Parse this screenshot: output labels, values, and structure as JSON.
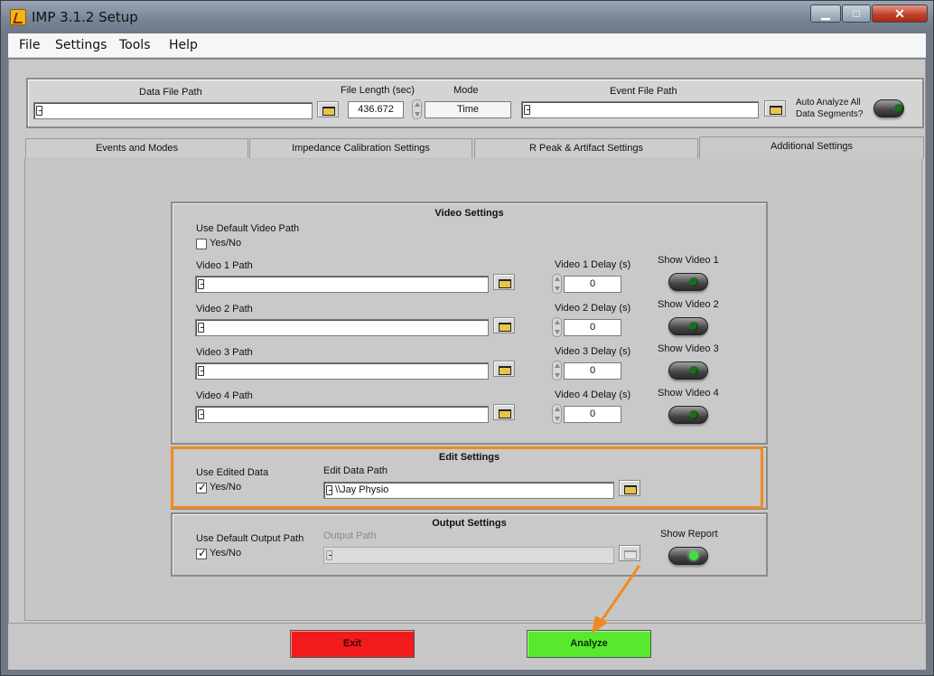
{
  "window": {
    "title": "IMP 3.1.2 Setup",
    "controls": {
      "minimize": "▁",
      "maximize": "□",
      "close": "✕"
    }
  },
  "menu": [
    "File",
    "Settings",
    "Tools",
    "Help"
  ],
  "top": {
    "data_file_label": "Data File Path",
    "data_file_value": "",
    "file_length_label": "File Length (sec)",
    "file_length_value": "436.672",
    "mode_label": "Mode",
    "mode_value": "Time",
    "event_file_label": "Event File Path",
    "event_file_value": "",
    "auto_analyze_label": "Auto Analyze All Data Segments?",
    "auto_analyze_on": false
  },
  "tabs": [
    {
      "label": "Events and Modes",
      "active": false
    },
    {
      "label": "Impedance Calibration Settings",
      "active": false
    },
    {
      "label": "R Peak & Artifact Settings",
      "active": false
    },
    {
      "label": "Additional Settings",
      "active": true
    }
  ],
  "video": {
    "title": "Video Settings",
    "default_label": "Use Default Video Path",
    "default_checkbox": "Yes/No",
    "default_checked": false,
    "rows": [
      {
        "path_label": "Video 1 Path",
        "path_value": "",
        "delay_label": "Video 1 Delay (s)",
        "delay_value": "0",
        "show_label": "Show Video 1"
      },
      {
        "path_label": "Video 2 Path",
        "path_value": "",
        "delay_label": "Video 2 Delay (s)",
        "delay_value": "0",
        "show_label": "Show Video 2"
      },
      {
        "path_label": "Video 3 Path",
        "path_value": "",
        "delay_label": "Video 3 Delay (s)",
        "delay_value": "0",
        "show_label": "Show Video 3"
      },
      {
        "path_label": "Video 4 Path",
        "path_value": "",
        "delay_label": "Video 4 Delay (s)",
        "delay_value": "0",
        "show_label": "Show Video 4"
      }
    ]
  },
  "edit": {
    "title": "Edit Settings",
    "use_label": "Use Edited Data",
    "use_checkbox": "Yes/No",
    "use_checked": true,
    "path_label": "Edit Data Path",
    "path_value": "\\\\Jay Physio"
  },
  "output": {
    "title": "Output Settings",
    "default_label": "Use Default Output Path",
    "default_checkbox": "Yes/No",
    "default_checked": true,
    "path_label": "Output Path",
    "path_value": "",
    "report_label": "Show Report",
    "report_on": true
  },
  "buttons": {
    "exit": "Exit",
    "analyze": "Analyze"
  },
  "colors": {
    "highlight": "#f08a20",
    "exit": "#f21b1b",
    "analyze": "#58e82d",
    "arrow": "#f08a20"
  }
}
